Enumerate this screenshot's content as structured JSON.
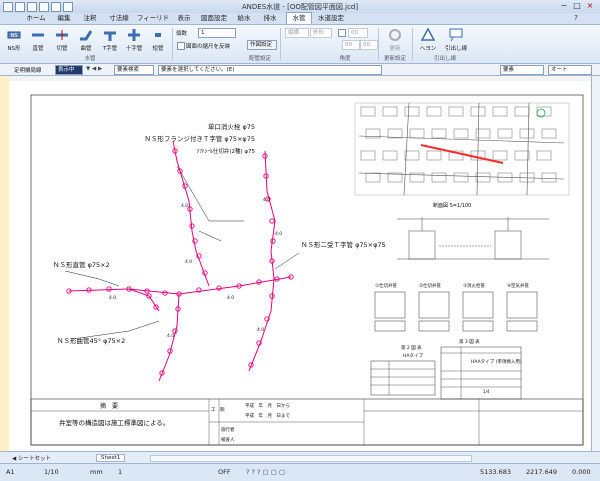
{
  "window": {
    "title": "ANDES水道 - [OO配管図平面図.jcd]",
    "controls": [
      "−",
      "□",
      "×"
    ]
  },
  "tabs": [
    {
      "label": "ホーム",
      "active": false
    },
    {
      "label": "編集",
      "active": false
    },
    {
      "label": "注釈",
      "active": false
    },
    {
      "label": "寸法線",
      "active": false
    },
    {
      "label": "フィーリド",
      "active": false
    },
    {
      "label": "表示",
      "active": false
    },
    {
      "label": "図面設定",
      "active": false
    },
    {
      "label": "給水",
      "active": false
    },
    {
      "label": "排水",
      "active": false
    },
    {
      "label": "水管",
      "active": true
    },
    {
      "label": "水道設定",
      "active": false
    }
  ],
  "ribbon": {
    "buttons": [
      {
        "label": "NS形",
        "icon": "ns-pipe-icon"
      },
      {
        "label": "直管",
        "icon": "straight-pipe-icon"
      },
      {
        "label": "切管",
        "icon": "cut-pipe-icon"
      },
      {
        "label": "曲管",
        "icon": "bend-pipe-icon"
      },
      {
        "label": "T字管",
        "icon": "tee-pipe-icon"
      },
      {
        "label": "十字管",
        "icon": "cross-pipe-icon"
      },
      {
        "label": "短管",
        "icon": "short-pipe-icon"
      }
    ],
    "group_pipe": "水管",
    "count_label": "個数",
    "count_value": "1",
    "checkbox_label": "図面の縮尺を反映",
    "settings_button": "作図設定",
    "group_settings": "配管設定",
    "gray_fields": [
      "縦横",
      "外形",
      "00",
      "00",
      "00"
    ],
    "group_angle": "角度",
    "btn_sync": "更新",
    "group_update": "更新設定",
    "btn_pipe_label": "ヘヨン",
    "btn_callout": "引出し線",
    "group_callout": "引出し線"
  },
  "toolbar2": {
    "layer_label": "定明機局線",
    "layer_select": "表示中",
    "element_label": "要素検索",
    "status_text": "要素を選択してください。(E)",
    "dropdown1": "要素",
    "dropdown2": "オート"
  },
  "drawing": {
    "label_hydrant": "単口消火栓 φ75",
    "label_ns_flange_tee": "ＮＳ形フランジ付きＴ字管 φ75×φ75",
    "label_valve": "ｿﾌﾄｼｰﾙ仕切弁(2種) φ75",
    "label_ns_double_tee": "ＮＳ形二受Ｔ字管 φ75×φ75",
    "label_ns_straight": "ＮＳ形直管 φ75×2",
    "label_ns_bend": "ＮＳ形曲管45° φ75×2",
    "dim_label": "4.0",
    "section_title": "断面図 S=1/100",
    "detail_titles": [
      "①仕切弁筐",
      "②仕切弁筐",
      "③消火栓筐",
      "④空気弁筐"
    ],
    "table_a_title": "第 2 図 表",
    "table_a_type": "HAタイプ",
    "table_b_title": "第 3 図 表",
    "table_b_type": "HAAタイプ (単項挿入用)",
    "table_b_page": "1/4",
    "notes_header": "摘　要",
    "note_text": "弁室等の構造図は施工標準図による。",
    "title_cells": [
      "工　期",
      "平成　年　月　日から",
      "平成　年　月　日まで",
      "施行者",
      "検査人"
    ]
  },
  "sheet_tab": "Sheet1",
  "sheet_nav": "◀ シートセット",
  "status": {
    "cell": "A1",
    "scale": "1/10",
    "unit": "mm",
    "one": "1",
    "snap": "OFF",
    "x": "5133.683",
    "y": "2217.649",
    "z": "0.000"
  },
  "colors": {
    "pipe": "#e8007f",
    "highlight": "#ff2a2a",
    "ribbon_accent": "#3b6db3"
  }
}
